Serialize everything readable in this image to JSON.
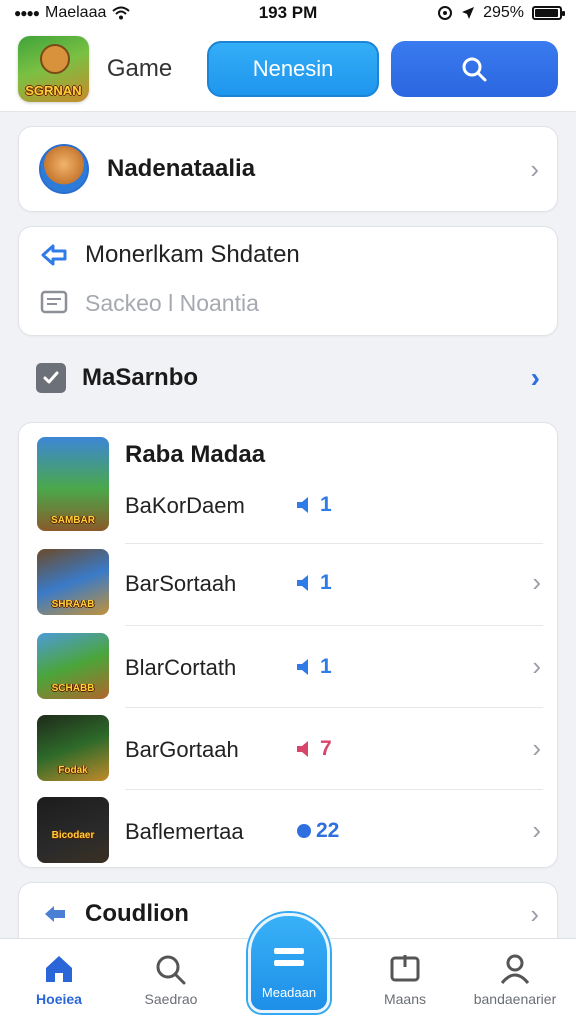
{
  "status_bar": {
    "carrier": "Maelaaa",
    "time": "193 PM",
    "battery_percent": "295%"
  },
  "header": {
    "title": "Game",
    "logo_text": "SGRNAN",
    "primary_button_label": "Nenesin"
  },
  "profile": {
    "name": "Nadenataalia"
  },
  "info": {
    "row1_text": "Monerlkam Shdaten",
    "row2_text": "Sackeo l Noantia"
  },
  "section": {
    "title": "MaSarnbo"
  },
  "games": {
    "header": "Raba Madaa",
    "items": [
      {
        "label": "BaKorDaem",
        "thumb_text": "SAMBAR",
        "badge_text": "1",
        "badge_color": "#2f7be8"
      },
      {
        "label": "BarSortaah",
        "thumb_text": "SHRAAB",
        "badge_text": "1",
        "badge_color": "#2f7be8"
      },
      {
        "label": "BlarCortath",
        "thumb_text": "SCHABB",
        "badge_text": "1",
        "badge_color": "#2f7be8"
      },
      {
        "label": "BarGortaah",
        "thumb_text": "Fodak",
        "badge_text": "7",
        "badge_color": "#d8456a"
      },
      {
        "label": "Baflemertaa",
        "thumb_text": "Bicodaer",
        "badge_text": "22",
        "badge_color": "#2f6fe0"
      }
    ]
  },
  "bottom_card": {
    "label": "Coudlion"
  },
  "tab_bar": {
    "tabs": [
      {
        "label": "Hoeiea",
        "icon": "home-icon",
        "active": true
      },
      {
        "label": "Saedrao",
        "icon": "search-icon",
        "active": false
      },
      {
        "label": "Meadaan",
        "icon": "menu-icon",
        "active": false
      },
      {
        "label": "Maans",
        "icon": "message-icon",
        "active": false
      },
      {
        "label": "bandaenarier",
        "icon": "person-icon",
        "active": false
      }
    ]
  },
  "colors": {
    "accent_blue": "#1e96ee",
    "search_blue": "#2a66e0",
    "background": "#f1f2f5"
  }
}
